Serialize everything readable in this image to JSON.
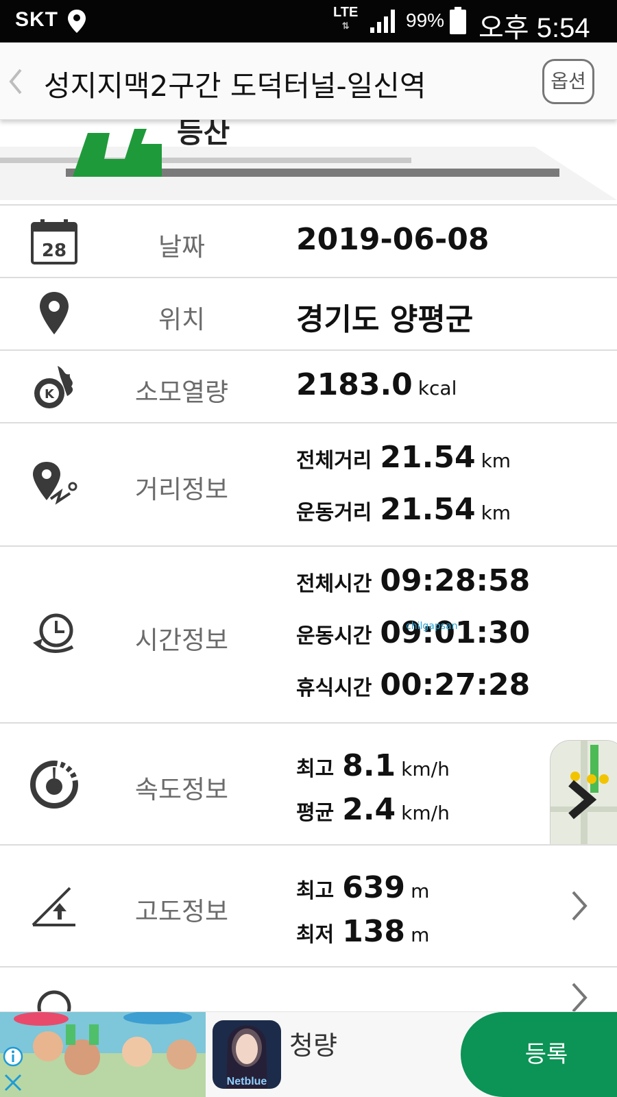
{
  "status_bar": {
    "carrier": "SKT",
    "network": "LTE",
    "battery": "99%",
    "time": "오후 5:54"
  },
  "header": {
    "title": "성지지맥2구간 도덕터널-일신역",
    "option_label": "옵션"
  },
  "banner": {
    "label": "등산"
  },
  "date": {
    "label": "날짜",
    "value": "2019-06-08",
    "icon_day": "28"
  },
  "location": {
    "label": "위치",
    "value": "경기도 양평군"
  },
  "calories": {
    "label": "소모열량",
    "value": "2183.0",
    "unit": "kcal",
    "icon_letter": "K"
  },
  "distance": {
    "label": "거리정보",
    "items": [
      {
        "label": "전체거리",
        "value": "21.54",
        "unit": "km"
      },
      {
        "label": "운동거리",
        "value": "21.54",
        "unit": "km"
      }
    ]
  },
  "time": {
    "label": "시간정보",
    "items": [
      {
        "label": "전체시간",
        "value": "09:28:58"
      },
      {
        "label": "운동시간",
        "value": "09:01:30"
      },
      {
        "label": "휴식시간",
        "value": "00:27:28"
      }
    ]
  },
  "speed": {
    "label": "속도정보",
    "items": [
      {
        "label": "최고",
        "value": "8.1",
        "unit": "km/h"
      },
      {
        "label": "평균",
        "value": "2.4",
        "unit": "km/h"
      }
    ]
  },
  "altitude": {
    "label": "고도정보",
    "items": [
      {
        "label": "최고",
        "value": "639",
        "unit": "m"
      },
      {
        "label": "최저",
        "value": "138",
        "unit": "m"
      }
    ]
  },
  "watermark": "chilgapsan",
  "ad": {
    "app_name": "청량",
    "app_icon_text": "Netblue",
    "button_label": "등록",
    "button_color": "#0c9356"
  },
  "colors": {
    "accent_green": "#1f9a3a",
    "label_gray": "#6b6b6b",
    "icon_dark": "#3a3a3a"
  }
}
